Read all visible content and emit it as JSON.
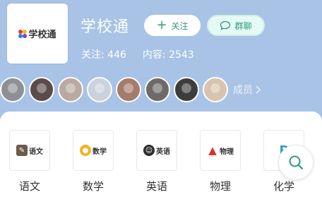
{
  "group": {
    "logo_text": "学校通",
    "title": "学校通",
    "follow_label": "关注",
    "chat_label": "群聊",
    "followers_label": "关注:",
    "followers_count": "446",
    "content_label": "内容:",
    "content_count": "2543"
  },
  "members": {
    "avatars": [
      {
        "color": "#8d8f95"
      },
      {
        "color": "#5b4c48"
      },
      {
        "color": "#b9a9a1"
      },
      {
        "color": "#c9d2de"
      },
      {
        "color": "#a57c6c"
      },
      {
        "color": "#6d6a68"
      },
      {
        "color": "#3d3d3d"
      },
      {
        "color": "#d8c3ad"
      }
    ],
    "link_label": "成员",
    "chevron": "chevron-right-icon"
  },
  "subjects": [
    {
      "label": "语文",
      "icon_text": "语文",
      "icon_color": "#6b5b4b",
      "icon_name": "chinese-book-icon"
    },
    {
      "label": "数学",
      "icon_text": "数学",
      "icon_color": "#f1b323",
      "icon_name": "math-icon"
    },
    {
      "label": "英语",
      "icon_text": "英语",
      "icon_color": "#2c2c2c",
      "icon_name": "english-icon"
    },
    {
      "label": "物理",
      "icon_text": "物理",
      "icon_color": "#d9312a",
      "icon_name": "physics-icon"
    },
    {
      "label": "化学",
      "icon_text": "",
      "icon_color": "#2aa3c8",
      "icon_name": "chemistry-icon"
    }
  ],
  "colors": {
    "header_bg": "#a8c3e6",
    "accent": "#2f9a7a"
  },
  "search_fab": {
    "icon": "search-icon"
  }
}
